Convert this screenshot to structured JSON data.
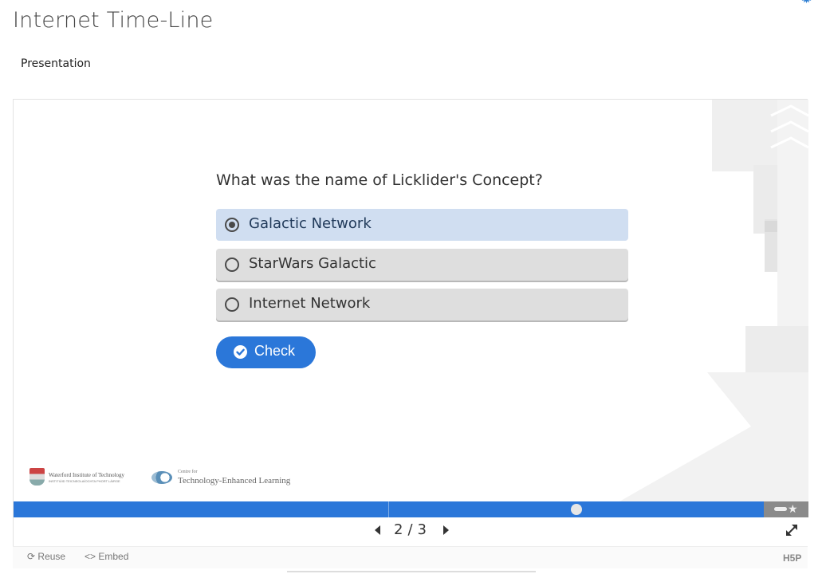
{
  "page": {
    "title": "Internet Time-Line",
    "subtitle": "Presentation"
  },
  "question": {
    "text": "What was the name of Licklider's Concept?",
    "answers": [
      {
        "label": "Galactic Network",
        "selected": true
      },
      {
        "label": "StarWars Galactic",
        "selected": false
      },
      {
        "label": "Internet Network",
        "selected": false
      }
    ],
    "check_label": "Check"
  },
  "logos": {
    "wit_name": "Waterford Institute of Technology",
    "wit_tagline": "INSTITIÚID TEICNEOLAÍOCHTA PHORT LÁIRGE",
    "tel_prefix": "Centre for",
    "tel_name": "Technology-Enhanced Learning"
  },
  "navigation": {
    "current": "2",
    "separator": "/",
    "total": "3",
    "progress_fraction": 0.71
  },
  "footer": {
    "reuse_label": "Reuse",
    "embed_label": "Embed",
    "brand": "H5P"
  },
  "colors": {
    "accent": "#2b77d9",
    "selected_answer": "#d0def1",
    "answer_bg": "#dedede"
  },
  "icons": [
    "gear-icon",
    "radio-selected-icon",
    "radio-icon",
    "check-circle-icon",
    "prev-arrow-icon",
    "next-arrow-icon",
    "summary-star-icon",
    "fullscreen-icon",
    "reuse-icon",
    "embed-icon"
  ]
}
